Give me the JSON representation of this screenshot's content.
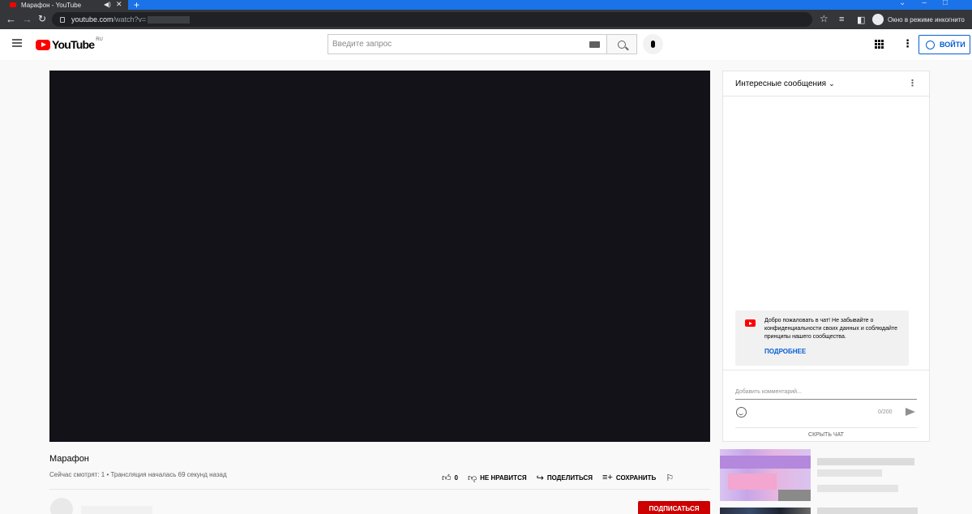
{
  "browser": {
    "tab_title": "Марафон - YouTube",
    "audio_icon": "speaker-icon",
    "url_host": "youtube.com",
    "url_path": "/watch?v=",
    "incognito_label": "Окно в режиме инкогнито"
  },
  "header": {
    "logo_text": "YouTube",
    "region": "RU",
    "search_placeholder": "Введите запрос",
    "signin_label": "ВОЙТИ"
  },
  "chat": {
    "header_title": "Интересные сообщения",
    "welcome_message": "Добро пожаловать в чат! Не забывайте о конфиденциальности своих данных и соблюдайте принципы нашего сообщества.",
    "learn_more": "ПОДРОБНЕЕ",
    "input_placeholder": "Добавить комментарий...",
    "char_counter": "0/200",
    "hide_chat": "СКРЫТЬ ЧАТ"
  },
  "video": {
    "title": "Марафон",
    "meta": "Сейчас смотрят: 1 • Трансляция началась 69 секунд назад",
    "like_count": "0",
    "dislike_label": "НЕ НРАВИТСЯ",
    "share_label": "ПОДЕЛИТЬСЯ",
    "save_label": "СОХРАНИТЬ",
    "subscribe_label": "ПОДПИСАТЬСЯ"
  },
  "colors": {
    "brand_red": "#ff0000",
    "link_blue": "#065fd4",
    "subscribe_red": "#cc0000",
    "player_bg": "#121218"
  }
}
